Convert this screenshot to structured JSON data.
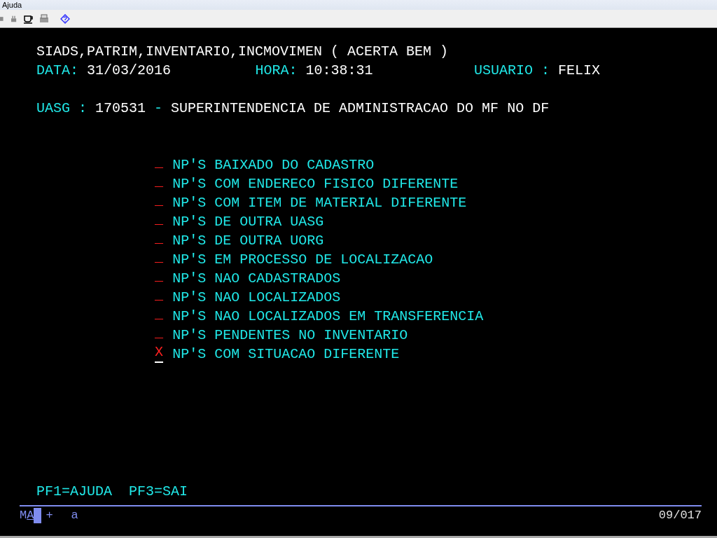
{
  "menu": [
    {
      "label": "Ajuda"
    }
  ],
  "screen": {
    "title": "SIADS,PATRIM,INVENTARIO,INCMOVIMEN ( ACERTA BEM )",
    "fields": [
      {
        "label": "DATA:",
        "value": "31/03/2016"
      },
      {
        "label": "HORA:",
        "value": "10:38:31"
      },
      {
        "label": "USUARIO :",
        "value": "FELIX"
      }
    ],
    "uasg": {
      "label": "UASG :",
      "code": "170531",
      "separator": "-",
      "name": "SUPERINTENDENCIA DE ADMINISTRACAO DO MF NO DF"
    },
    "options": [
      {
        "input": "_",
        "label": "NP'S BAIXADO DO CADASTRO",
        "cursor": false
      },
      {
        "input": "_",
        "label": "NP'S COM ENDERECO FISICO DIFERENTE",
        "cursor": false
      },
      {
        "input": "_",
        "label": "NP'S COM ITEM DE MATERIAL DIFERENTE",
        "cursor": false
      },
      {
        "input": "_",
        "label": "NP'S DE OUTRA UASG",
        "cursor": false
      },
      {
        "input": "_",
        "label": "NP'S DE OUTRA UORG",
        "cursor": false
      },
      {
        "input": "_",
        "label": "NP'S EM PROCESSO DE LOCALIZACAO",
        "cursor": false
      },
      {
        "input": "_",
        "label": "NP'S NAO CADASTRADOS",
        "cursor": false
      },
      {
        "input": "_",
        "label": "NP'S NAO LOCALIZADOS",
        "cursor": false
      },
      {
        "input": "_",
        "label": "NP'S NAO LOCALIZADOS EM TRANSFERENCIA",
        "cursor": false
      },
      {
        "input": "_",
        "label": "NP'S PENDENTES NO INVENTARIO",
        "cursor": false
      },
      {
        "input": "X",
        "label": "NP'S COM SITUACAO DIFERENTE",
        "cursor": true
      }
    ],
    "function_keys": [
      {
        "text": "PF1=AJUDA"
      },
      {
        "text": "PF3=SAI"
      }
    ]
  },
  "status_bar": {
    "indicators": [
      {
        "text": "M",
        "underlined": false
      },
      {
        "text": "A",
        "underlined": true
      }
    ],
    "shift": "+",
    "input_mode": "a",
    "cursor_position": "09/017"
  }
}
